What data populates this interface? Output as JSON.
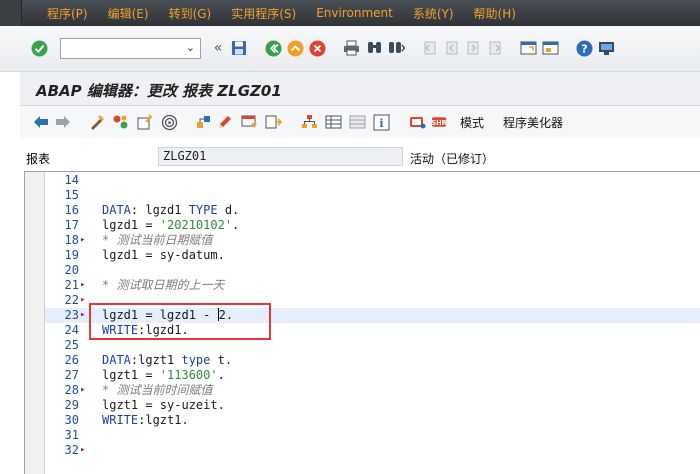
{
  "menu": [
    "程序(P)",
    "编辑(E)",
    "转到(G)",
    "实用程序(S)",
    "Environment",
    "系统(Y)",
    "帮助(H)"
  ],
  "command_field": {
    "value": "",
    "placeholder": ""
  },
  "standard_toolbar_icons": [
    "check-icon",
    "back-icon",
    "save-icon",
    "back-nav-icon",
    "exit-icon",
    "cancel-icon",
    "print-icon",
    "find-icon",
    "find-next-icon",
    "first-page-icon",
    "prev-page-icon",
    "next-page-icon",
    "last-page-icon",
    "new-session-icon",
    "shortcut-icon",
    "help-icon",
    "layout-icon"
  ],
  "title": "ABAP 编辑器：更改 报表 ZLGZ01",
  "app_toolbar": {
    "pattern_label": "模式",
    "pretty_printer_label": "程序美化器"
  },
  "program": {
    "label": "报表",
    "name": "ZLGZ01",
    "status": "活动（已修订）"
  },
  "colors": {
    "menu_text": "#f0a02a",
    "keyword": "#1c3fae",
    "string": "#2e8c3a",
    "comment": "#7d7d7d",
    "highlight_box": "#e8333a"
  },
  "editor": {
    "lines": [
      {
        "n": "14",
        "mk": false,
        "parts": []
      },
      {
        "n": "15",
        "mk": false,
        "parts": []
      },
      {
        "n": "16",
        "mk": false,
        "parts": [
          {
            "t": "DATA",
            "c": "kw"
          },
          {
            "t": ": lgzd1 ",
            "c": ""
          },
          {
            "t": "TYPE",
            "c": "kw"
          },
          {
            "t": " d.",
            "c": ""
          }
        ]
      },
      {
        "n": "17",
        "mk": false,
        "parts": [
          {
            "t": "lgzd1 = ",
            "c": ""
          },
          {
            "t": "'20210102'",
            "c": "str"
          },
          {
            "t": ".",
            "c": ""
          }
        ]
      },
      {
        "n": "18",
        "mk": true,
        "parts": [
          {
            "t": "* 测试当前日期赋值",
            "c": "cmt"
          }
        ]
      },
      {
        "n": "19",
        "mk": false,
        "parts": [
          {
            "t": "lgzd1 = sy-datum.",
            "c": ""
          }
        ]
      },
      {
        "n": "20",
        "mk": false,
        "parts": []
      },
      {
        "n": "21",
        "mk": true,
        "parts": [
          {
            "t": "* 测试取日期的上一天",
            "c": "cmt"
          }
        ]
      },
      {
        "n": "22",
        "mk": true,
        "parts": []
      },
      {
        "n": "23",
        "mk": true,
        "parts": [
          {
            "t": "lgzd1 = lgzd1 - ",
            "c": ""
          },
          {
            "t": "|",
            "c": "cursor"
          },
          {
            "t": "2.",
            "c": ""
          }
        ]
      },
      {
        "n": "24",
        "mk": false,
        "parts": [
          {
            "t": "WRITE",
            "c": "kw"
          },
          {
            "t": ":lgzd1.",
            "c": ""
          }
        ]
      },
      {
        "n": "25",
        "mk": false,
        "parts": []
      },
      {
        "n": "26",
        "mk": false,
        "parts": [
          {
            "t": "DATA",
            "c": "kw"
          },
          {
            "t": ":lgzt1 ",
            "c": ""
          },
          {
            "t": "type",
            "c": "kw"
          },
          {
            "t": " t.",
            "c": ""
          }
        ]
      },
      {
        "n": "27",
        "mk": false,
        "parts": [
          {
            "t": "lgzt1 = ",
            "c": ""
          },
          {
            "t": "'113600'",
            "c": "str"
          },
          {
            "t": ".",
            "c": ""
          }
        ]
      },
      {
        "n": "28",
        "mk": true,
        "parts": [
          {
            "t": "* 测试当前时间赋值",
            "c": "cmt"
          }
        ]
      },
      {
        "n": "29",
        "mk": false,
        "parts": [
          {
            "t": "lgzt1 = sy-uzeit.",
            "c": ""
          }
        ]
      },
      {
        "n": "30",
        "mk": false,
        "parts": [
          {
            "t": "WRITE",
            "c": "kw"
          },
          {
            "t": ":lgzt1.",
            "c": ""
          }
        ]
      },
      {
        "n": "31",
        "mk": false,
        "parts": []
      },
      {
        "n": "32",
        "mk": true,
        "parts": []
      }
    ]
  }
}
